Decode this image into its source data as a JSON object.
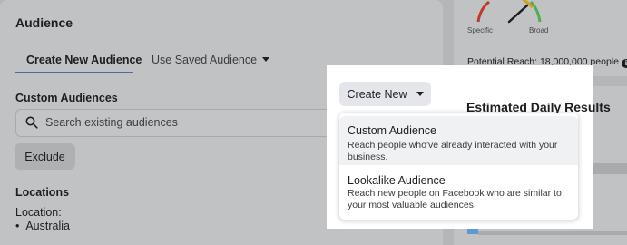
{
  "audience": {
    "title": "Audience",
    "tabs": [
      {
        "label": "Create New Audience",
        "active": true
      },
      {
        "label": "Use Saved Audience",
        "active": false
      }
    ],
    "custom_audiences_label": "Custom Audiences",
    "search": {
      "placeholder": "Search existing audiences"
    },
    "exclude_label": "Exclude",
    "locations_label": "Locations",
    "location_label": "Location:",
    "location_value": "Australia"
  },
  "create_new": {
    "label": "Create New",
    "menu": [
      {
        "title": "Custom Audience",
        "description": "Reach people who've already interacted with your business."
      },
      {
        "title": "Lookalike Audience",
        "description": "Reach new people on Facebook who are similar to your most valuable audiences."
      }
    ]
  },
  "definition": {
    "specific_label": "Specific",
    "broad_label": "Broad",
    "potential_reach": "Potential Reach: 18,000,000 people",
    "info_icon": "i"
  },
  "estimated": {
    "title": "Estimated Daily Results"
  },
  "colors": {
    "accent": "#4a6ea0",
    "gauge_red": "#c0392b",
    "gauge_yellow": "#d4a017",
    "gauge_green": "#4caf50",
    "highlight": "#5b9bd5"
  }
}
